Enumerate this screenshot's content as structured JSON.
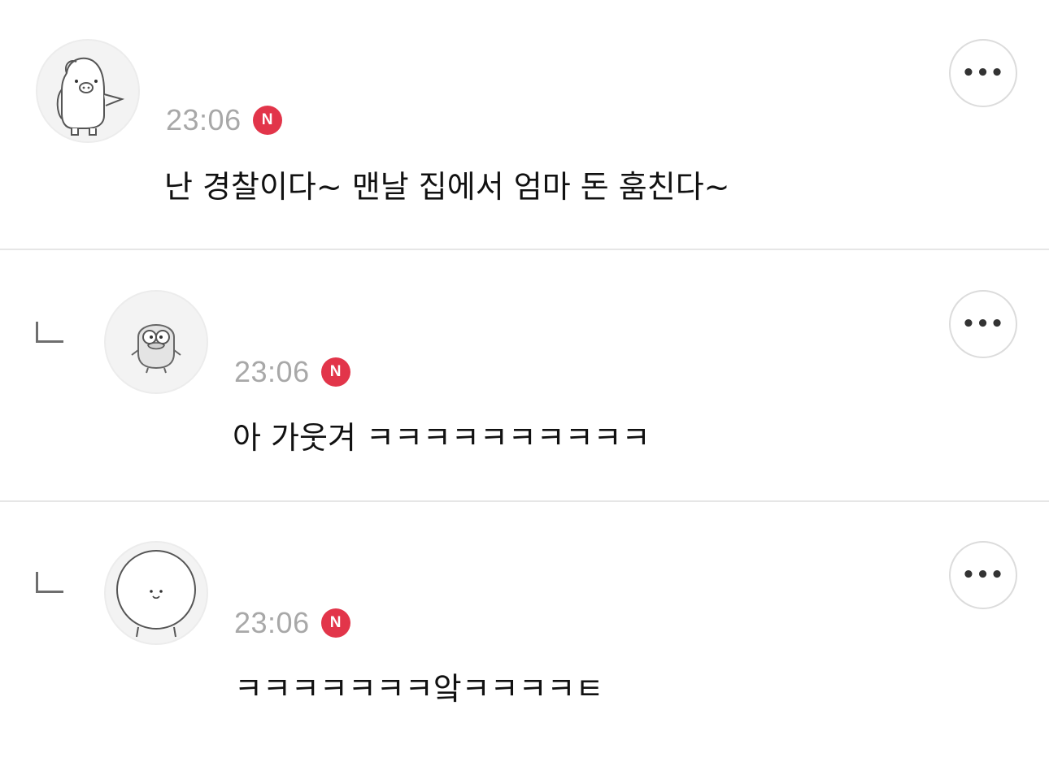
{
  "comments": [
    {
      "is_reply": false,
      "avatar_icon": "pig-character-icon",
      "time": "23:06",
      "badge": "N",
      "text": "난 경찰이다~ 맨날 집에서 엄마 돈 훔친다~",
      "more_icon": "more-options-icon",
      "more_label": "•••"
    },
    {
      "is_reply": true,
      "avatar_icon": "duck-character-icon",
      "time": "23:06",
      "badge": "N",
      "text": "아 가웃겨 ㅋㅋㅋㅋㅋㅋㅋㅋㅋㅋ",
      "more_icon": "more-options-icon",
      "more_label": "•••"
    },
    {
      "is_reply": true,
      "avatar_icon": "round-face-character-icon",
      "time": "23:06",
      "badge": "N",
      "text": "ㅋㅋㅋㅋㅋㅋㅋ앜ㅋㅋㅋㅋㅌ",
      "more_icon": "more-options-icon",
      "more_label": "•••"
    }
  ],
  "colors": {
    "badge": "#e2354a",
    "timestamp": "#a8a8a8",
    "divider": "#e6e6e6",
    "text": "#111111"
  }
}
